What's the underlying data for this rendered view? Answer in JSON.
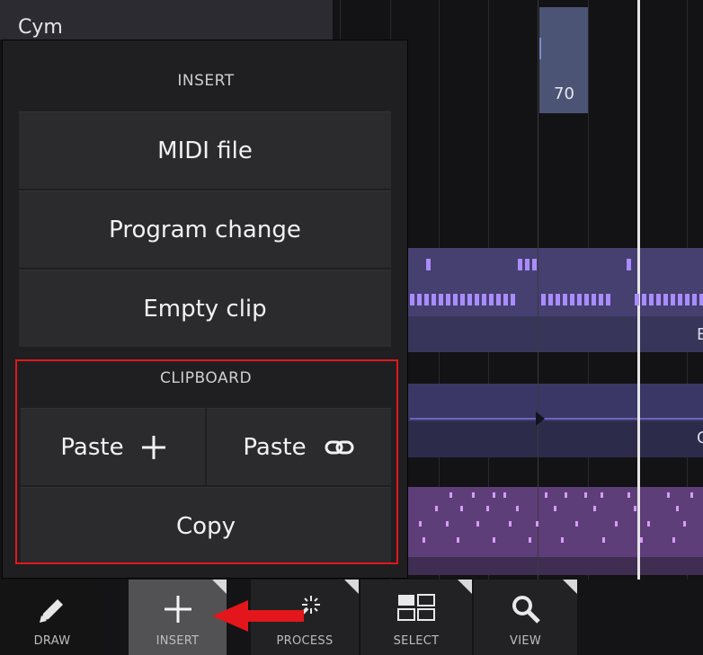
{
  "track": {
    "name": "Cym",
    "tempo_label": "70"
  },
  "clip_letters": {
    "purple": "E",
    "violet": "C"
  },
  "popup": {
    "insert_title": "INSERT",
    "items": {
      "midi_file": "MIDI file",
      "program_change": "Program change",
      "empty_clip": "Empty clip"
    },
    "clipboard_title": "CLIPBOARD",
    "clipboard": {
      "paste_new": "Paste",
      "paste_linked": "Paste",
      "copy": "Copy"
    }
  },
  "toolbar": {
    "draw": "DRAW",
    "insert": "INSERT",
    "process": "PROCESS",
    "select": "SELECT",
    "view": "VIEW"
  },
  "colors": {
    "highlight": "#e2161b",
    "arrow": "#e2161b",
    "active_tool": "#525254"
  }
}
